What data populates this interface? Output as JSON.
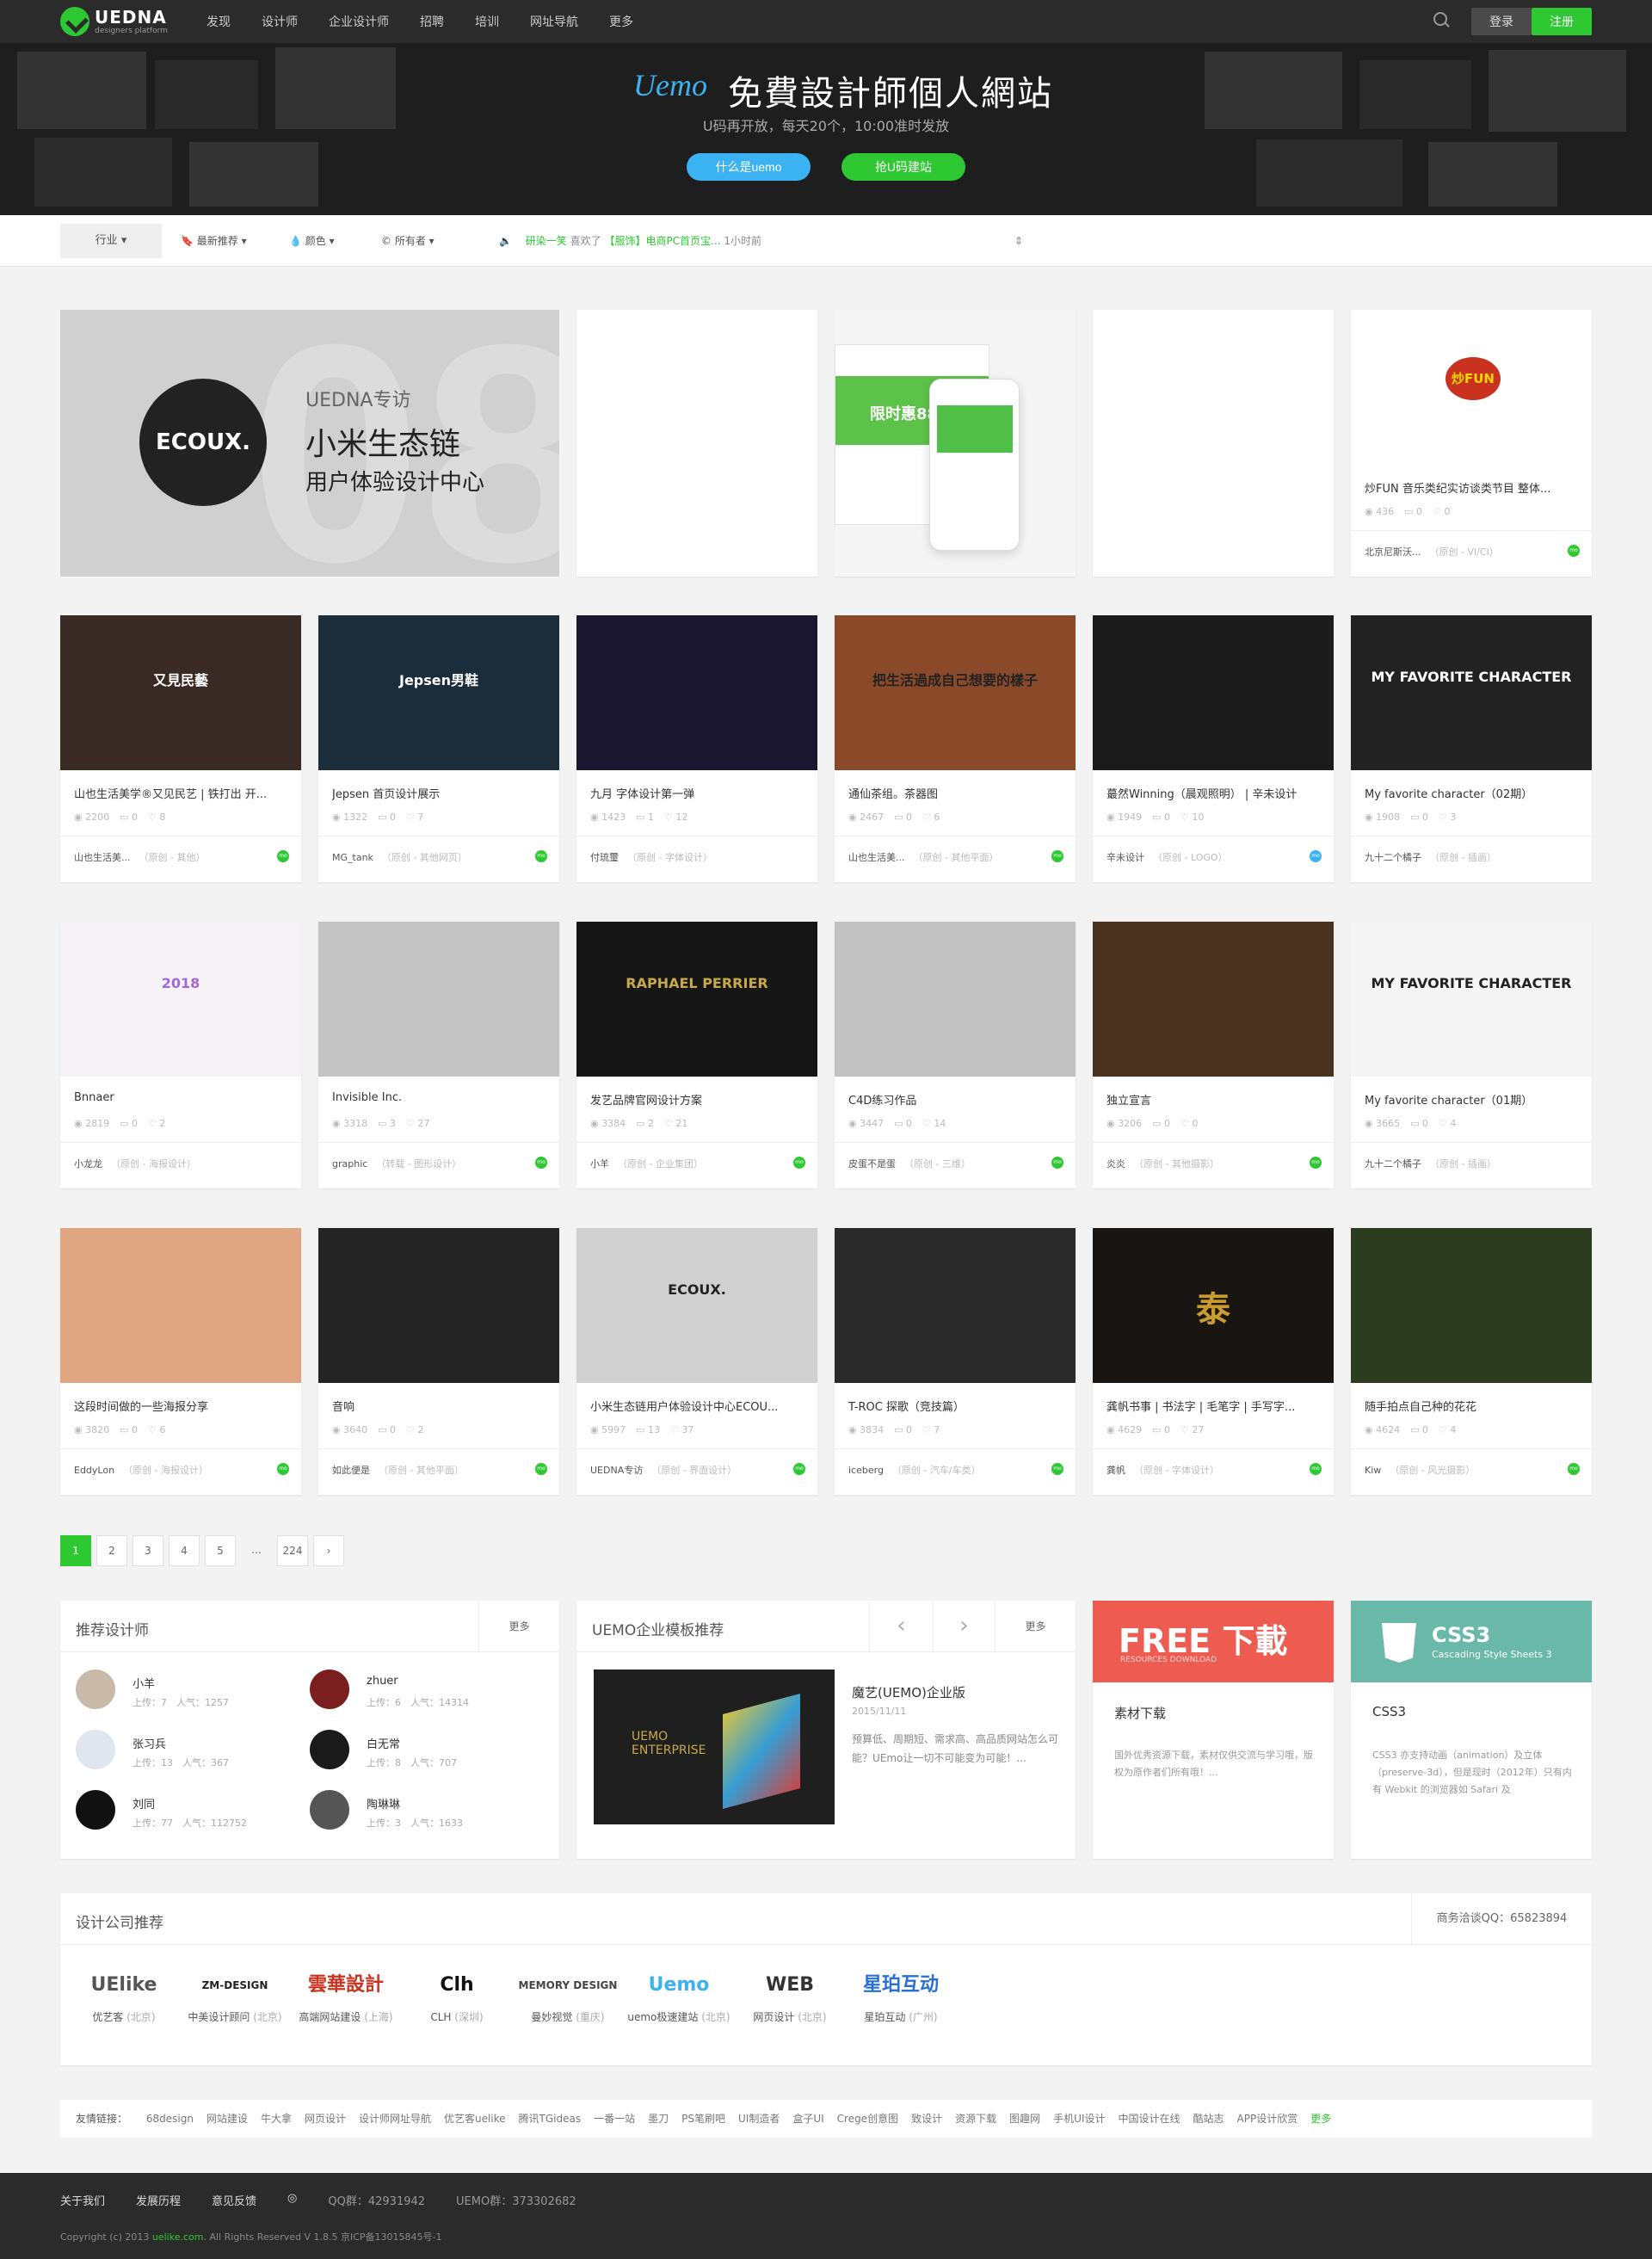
{
  "header": {
    "logo_text": "UEDNA",
    "logo_sub": "designers platform",
    "nav": [
      "发现",
      "设计师",
      "企业设计师",
      "招聘",
      "培训",
      "网址导航",
      "更多"
    ],
    "login": "登录",
    "register": "注册"
  },
  "banner": {
    "logo": "Uemo",
    "title": "免費設計師個人網站",
    "subtitle": "U码再开放，每天20个，10:00准时发放",
    "btn_what": "什么是uemo",
    "btn_grab": "抢U码建站"
  },
  "filter": {
    "industry": "行业",
    "sort": "最新推荐",
    "color": "颜色",
    "owner": "所有者",
    "news_user": "研染一笑",
    "news_action": "喜欢了",
    "news_item": "【服饰】电商PC首页宝...",
    "news_time": "1小时前"
  },
  "ad": {
    "brand": "ECOUX.",
    "label": "UEDNA专访",
    "line1": "小米生态链",
    "line2": "用户体验设计中心",
    "bg_number": "08"
  },
  "row1": [
    {
      "title": "",
      "views": "",
      "comments": "",
      "likes": "",
      "author": "",
      "category": ""
    },
    {
      "title": "",
      "views": "",
      "comments": "",
      "likes": "",
      "author": "",
      "category": ""
    },
    {
      "title": "",
      "views": "",
      "comments": "",
      "likes": "",
      "author": "",
      "category": ""
    },
    {
      "title": "炒FUN 音乐类纪实访谈类节目 整体...",
      "views": "436",
      "comments": "0",
      "likes": "0",
      "author": "北京尼斯沃...",
      "category": "（原创 - VI/CI）"
    }
  ],
  "row1_mobile": {
    "title": "限时惠88"
  },
  "row1_logo": {
    "text": "炒FUN"
  },
  "rows": [
    [
      {
        "title": "山也生活美学®又见民艺 | 铁打出 开...",
        "views": "2200",
        "comments": "0",
        "likes": "8",
        "author": "山也生活美...",
        "category": "（原创 - 其他）",
        "thumb": "又見民藝"
      },
      {
        "title": "Jepsen 首页设计展示",
        "views": "1322",
        "comments": "0",
        "likes": "7",
        "author": "MG_tank",
        "category": "（原创 - 其他网页）",
        "thumb": "Jepsen男鞋"
      },
      {
        "title": "九月 字体设计第一弹",
        "views": "1423",
        "comments": "1",
        "likes": "12",
        "author": "付琉璽",
        "category": "（原创 - 字体设计）",
        "thumb": ""
      },
      {
        "title": "通仙茶组。茶器图",
        "views": "2467",
        "comments": "0",
        "likes": "6",
        "author": "山也生活美...",
        "category": "（原创 - 其他平面）",
        "thumb": "把生活過成自己想要的樣子"
      },
      {
        "title": "蕞然Winning（晨观照明） | 辛未设计",
        "views": "1949",
        "comments": "0",
        "likes": "10",
        "author": "辛未设计",
        "category": "（原创 - LOGO）",
        "thumb": ""
      },
      {
        "title": "My favorite character（02期）",
        "views": "1908",
        "comments": "0",
        "likes": "3",
        "author": "九十二个橘子",
        "category": "（原创 - 插画）",
        "thumb": "MY FAVORITE CHARACTER"
      }
    ],
    [
      {
        "title": "Bnnaer",
        "views": "2819",
        "comments": "0",
        "likes": "2",
        "author": "小龙龙",
        "category": "（原创 - 海报设计）",
        "thumb": "2018"
      },
      {
        "title": "Invisible Inc.",
        "views": "3318",
        "comments": "3",
        "likes": "27",
        "author": "graphic",
        "category": "（转载 - 图形设计）",
        "thumb": ""
      },
      {
        "title": "发艺品牌官网设计方案",
        "views": "3384",
        "comments": "2",
        "likes": "21",
        "author": "小羊",
        "category": "（原创 - 企业集团）",
        "thumb": "RAPHAEL PERRIER"
      },
      {
        "title": "C4D练习作品",
        "views": "3447",
        "comments": "0",
        "likes": "14",
        "author": "皮蛋不是蛋",
        "category": "（原创 - 三维）",
        "thumb": ""
      },
      {
        "title": "独立宣言",
        "views": "3206",
        "comments": "0",
        "likes": "0",
        "author": "炎炎",
        "category": "（原创 - 其他摄影）",
        "thumb": ""
      },
      {
        "title": "My favorite character（01期）",
        "views": "3665",
        "comments": "0",
        "likes": "4",
        "author": "九十二个橘子",
        "category": "（原创 - 插画）",
        "thumb": "MY FAVORITE CHARACTER"
      }
    ],
    [
      {
        "title": "这段时间做的一些海报分享",
        "views": "3820",
        "comments": "0",
        "likes": "6",
        "author": "EddyLon",
        "category": "（原创 - 海报设计）",
        "thumb": ""
      },
      {
        "title": "音响",
        "views": "3640",
        "comments": "0",
        "likes": "2",
        "author": "如此便是",
        "category": "（原创 - 其他平面）",
        "thumb": ""
      },
      {
        "title": "小米生态链用户体验设计中心ECOU...",
        "views": "5997",
        "comments": "13",
        "likes": "37",
        "author": "UEDNA专访",
        "category": "（原创 - 界面设计）",
        "thumb": "ECOUX."
      },
      {
        "title": "T-ROC 探歌（竞技篇）",
        "views": "3834",
        "comments": "0",
        "likes": "7",
        "author": "iceberg",
        "category": "（原创 - 汽车/车类）",
        "thumb": ""
      },
      {
        "title": "龚帆书事 | 书法字 | 毛笔字 | 手写字...",
        "views": "4629",
        "comments": "0",
        "likes": "27",
        "author": "龚帆",
        "category": "（原创 - 字体设计）",
        "thumb": "泰"
      },
      {
        "title": "随手拍点自己种的花花",
        "views": "4624",
        "comments": "0",
        "likes": "4",
        "author": "Kiw",
        "category": "（原创 - 风光摄影）",
        "thumb": ""
      }
    ]
  ],
  "pager": [
    "1",
    "2",
    "3",
    "4",
    "5",
    "...",
    "224"
  ],
  "designers": {
    "title": "推荐设计师",
    "more": "更多",
    "list": [
      {
        "name": "小羊",
        "stats": "上传：7　人气：1257"
      },
      {
        "name": "zhuer",
        "stats": "上传：6　人气：14314"
      },
      {
        "name": "张习兵",
        "stats": "上传：13　人气：367"
      },
      {
        "name": "白无常",
        "stats": "上传：8　人气：707"
      },
      {
        "name": "刘同",
        "stats": "上传：77　人气：112752"
      },
      {
        "name": "陶琳琳",
        "stats": "上传：3　人气：1633"
      }
    ]
  },
  "templates": {
    "title": "UEMO企业模板推荐",
    "more": "更多",
    "name": "魔艺(UEMO)企业版",
    "date": "2015/11/11",
    "desc": "预算低、周期短、需求高、高品质网站怎么可能？UEmo让一切不可能变为可能！...",
    "thumb": "UEMO ENTERPRISE"
  },
  "promo1": {
    "banner_big": "FREE 下載",
    "banner_sub": "RESOURCES DOWNLOAD",
    "title": "素材下载",
    "desc": "国外优秀资源下载，素材仅供交流与学习哦，版权为原作者们所有哦！..."
  },
  "promo2": {
    "banner_big": "CSS3",
    "banner_sub": "Cascading Style Sheets 3",
    "title": "CSS3",
    "desc": "CSS3 亦支持动画（animation）及立体（preserve-3d），但是现时（2012年）只有内有 Webkit 的浏览器如 Safari 及"
  },
  "companies": {
    "title": "设计公司推荐",
    "contact": "商务洽谈QQ：65823894",
    "list": [
      {
        "logo": "UElike",
        "name": "优艺客",
        "city": "(北京)"
      },
      {
        "logo": "ZM-DESIGN",
        "name": "中美设计顾问",
        "city": "(北京)"
      },
      {
        "logo": "雲華設計",
        "name": "高端网站建设",
        "city": "(上海)"
      },
      {
        "logo": "Clh",
        "name": "CLH",
        "city": "(深圳)"
      },
      {
        "logo": "MEMORY DESIGN",
        "name": "曼妙视觉",
        "city": "(重庆)"
      },
      {
        "logo": "Uemo",
        "name": "uemo极速建站",
        "city": "(北京)"
      },
      {
        "logo": "WEB",
        "name": "网页设计",
        "city": "(北京)"
      },
      {
        "logo": "星珀互动",
        "name": "星珀互动",
        "city": "(广州)"
      }
    ]
  },
  "links": {
    "label": "友情链接：",
    "items": [
      "68design",
      "网站建设",
      "牛大拿",
      "网页设计",
      "设计师网址导航",
      "优艺客uelike",
      "腾讯TGideas",
      "一番一站",
      "墨刀",
      "PS笔刷吧",
      "UI制造者",
      "盒子UI",
      "Crege创意图",
      "致设计",
      "资源下载",
      "图趣网",
      "手机UI设计",
      "中国设计在线",
      "酷站志",
      "APP设计欣赏"
    ],
    "more": "更多"
  },
  "footer": {
    "links": [
      "关于我们",
      "发展历程",
      "意见反馈"
    ],
    "qq": "QQ群：42931942",
    "uemo": "UEMO群：373302682",
    "copy_pre": "Copyright (c) 2013 ",
    "copy_site": "uelike.com",
    "copy_post": ". All Rights Reserved V 1.8.5 京ICP备13015845号-1"
  }
}
